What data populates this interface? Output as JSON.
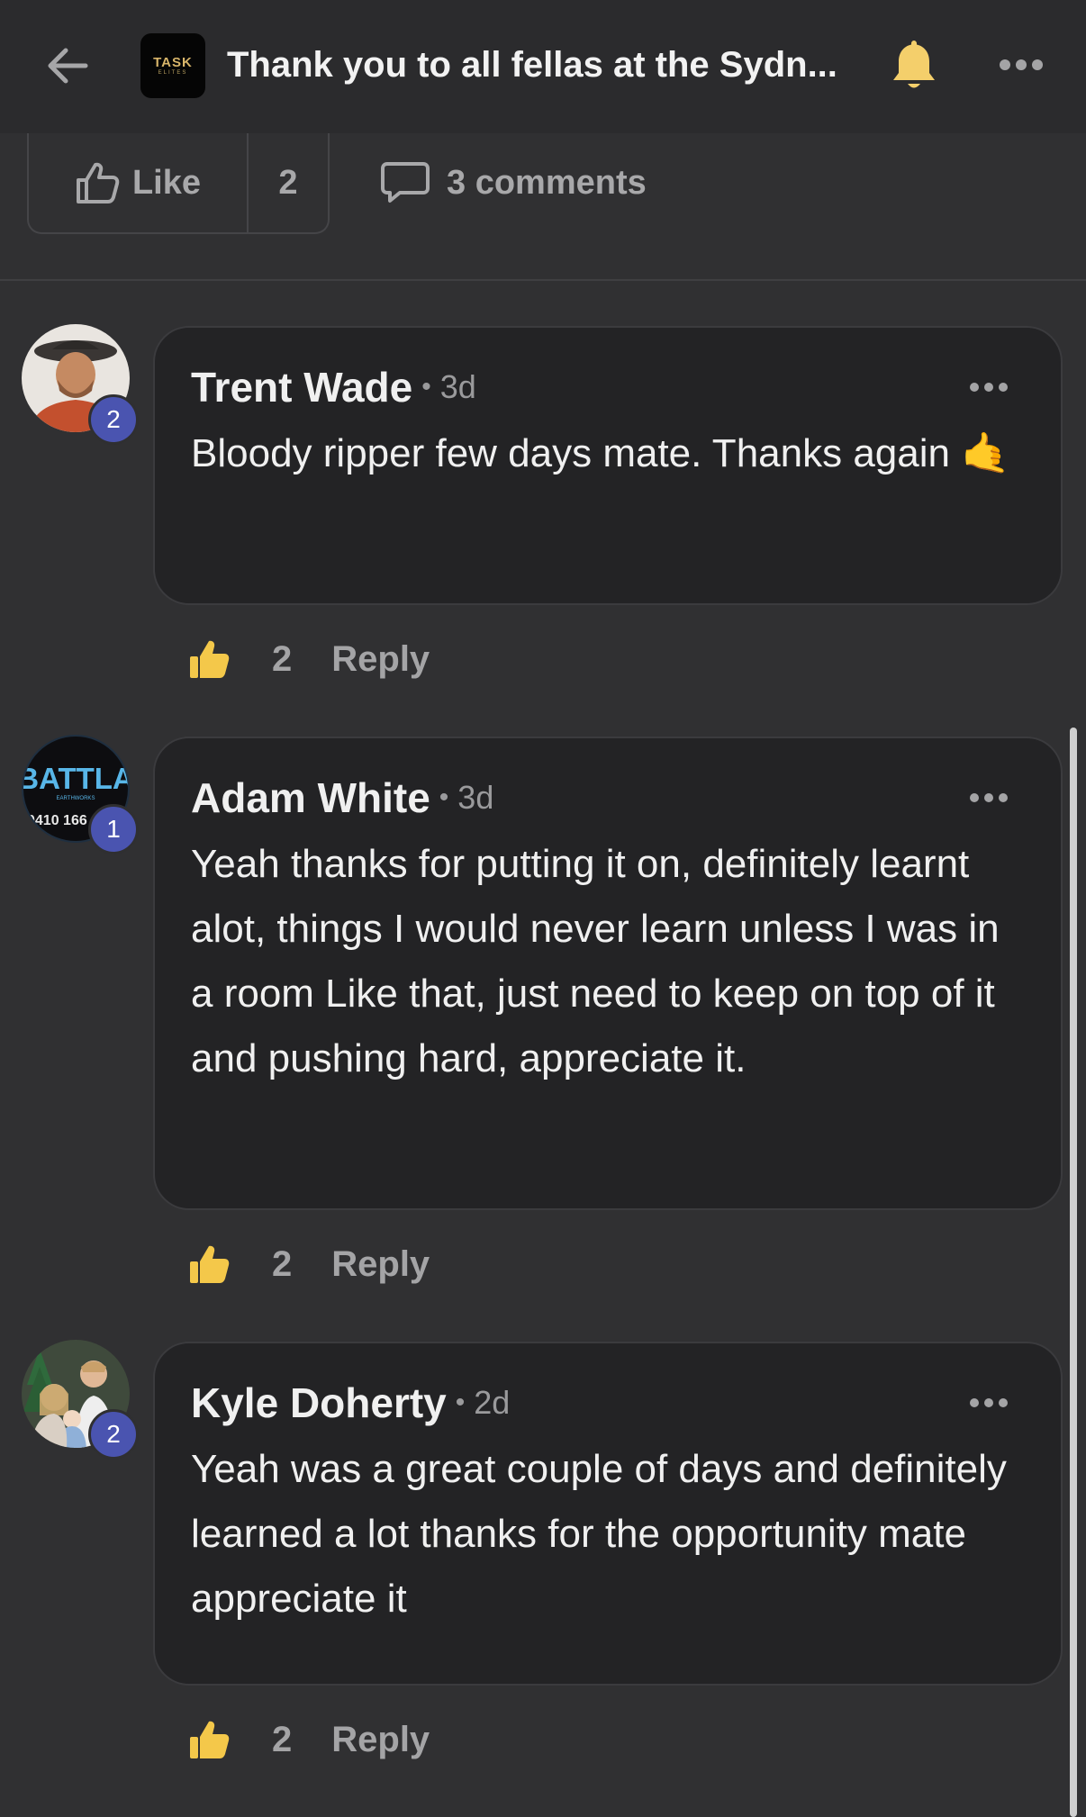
{
  "header": {
    "group_logo_text": "TASK",
    "group_logo_subtext": "ELITES",
    "title": "Thank you to all fellas at the Sydn...",
    "accent": "#f4cf6b"
  },
  "post_actions": {
    "like_label": "Like",
    "like_count": "2",
    "comments_label": "3 comments"
  },
  "comments": [
    {
      "author": "Trent Wade",
      "separator": "•",
      "time": "3d",
      "badge": "2",
      "text": "Bloody ripper few days mate. Thanks again 🤙",
      "like_count": "2",
      "reply_label": "Reply",
      "avatar_icon": "person-photo"
    },
    {
      "author": "Adam White",
      "separator": "•",
      "time": "3d",
      "badge": "1",
      "avatar_logo_text": "BATTLA",
      "avatar_logo_sub": "EARTHWORKS",
      "avatar_logo_phone": "0410 166",
      "text": "Yeah thanks for putting it on, definitely learnt alot, things I would never learn unless I was in a room Like that, just need to keep on top of it and pushing hard, appreciate it.",
      "like_count": "2",
      "reply_label": "Reply"
    },
    {
      "author": "Kyle Doherty",
      "separator": "•",
      "time": "2d",
      "badge": "2",
      "text": "Yeah was a great couple of days and definitely learned a lot thanks for the opportunity mate appreciate it",
      "like_count": "2",
      "reply_label": "Reply",
      "avatar_icon": "family-photo"
    }
  ],
  "colors": {
    "background": "#303032",
    "bubble": "#232325",
    "badge": "#4a54b0",
    "thumb": "#f4c84a"
  }
}
